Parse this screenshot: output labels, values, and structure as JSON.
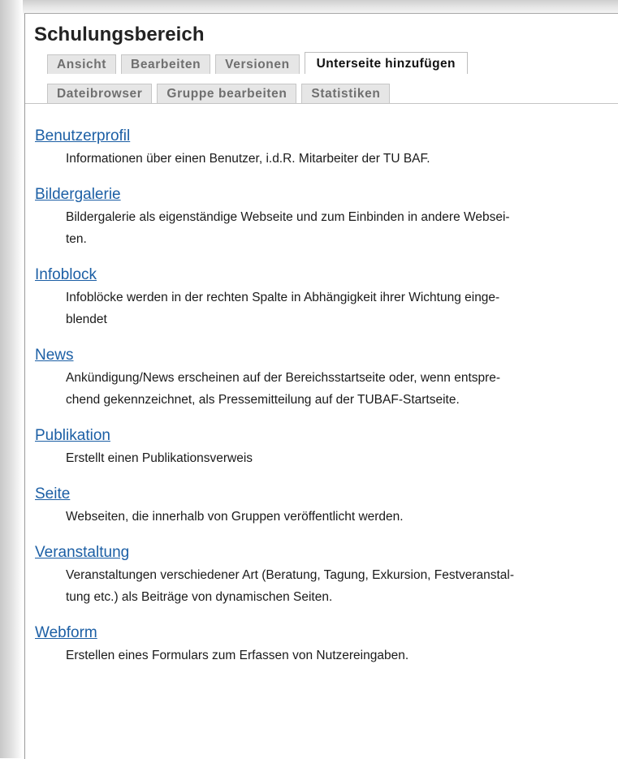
{
  "page": {
    "title": "Schulungsbereich"
  },
  "tabs": {
    "row1": [
      {
        "label": "Ansicht",
        "active": false
      },
      {
        "label": "Bearbeiten",
        "active": false
      },
      {
        "label": "Versionen",
        "active": false
      },
      {
        "label": "Unterseite hinzufügen",
        "active": true
      }
    ],
    "row2": [
      {
        "label": "Dateibrowser",
        "active": false
      },
      {
        "label": "Gruppe bearbeiten",
        "active": false
      },
      {
        "label": "Statistiken",
        "active": false
      }
    ]
  },
  "content_types": [
    {
      "name": "Benutzerprofil",
      "desc_lines": [
        "Informationen über einen Benutzer, i.d.R. Mitarbeiter der TU BAF."
      ]
    },
    {
      "name": "Bildergalerie",
      "desc_lines": [
        "Bildergalerie als eigenständige Webseite und zum Einbinden in andere Websei-",
        "ten."
      ]
    },
    {
      "name": "Infoblock",
      "desc_lines": [
        "Infoblöcke werden in der rechten Spalte in Abhängigkeit ihrer Wichtung einge-",
        "blendet"
      ]
    },
    {
      "name": "News",
      "desc_lines": [
        "Ankündigung/News erscheinen auf der Bereichsstartseite oder, wenn entspre-",
        "chend gekennzeichnet, als Pressemitteilung auf der TUBAF-Startseite."
      ]
    },
    {
      "name": "Publikation",
      "desc_lines": [
        "Erstellt einen Publikationsverweis"
      ]
    },
    {
      "name": "Seite",
      "desc_lines": [
        "Webseiten, die innerhalb von Gruppen veröffentlicht werden."
      ]
    },
    {
      "name": "Veranstaltung",
      "desc_lines": [
        "Veranstaltungen verschiedener Art (Beratung, Tagung, Exkursion, Festveranstal-",
        "tung etc.) als Beiträge von dynamischen Seiten."
      ]
    },
    {
      "name": "Webform",
      "desc_lines": [
        "Erstellen eines Formulars zum Erfassen von Nutzereingaben."
      ]
    }
  ],
  "colors": {
    "link": "#1c5fa5",
    "tab_inactive_bg": "#e6e6e6",
    "tab_inactive_text": "#6f6f6f",
    "tab_active_text": "#111111",
    "title_text": "#222222"
  }
}
